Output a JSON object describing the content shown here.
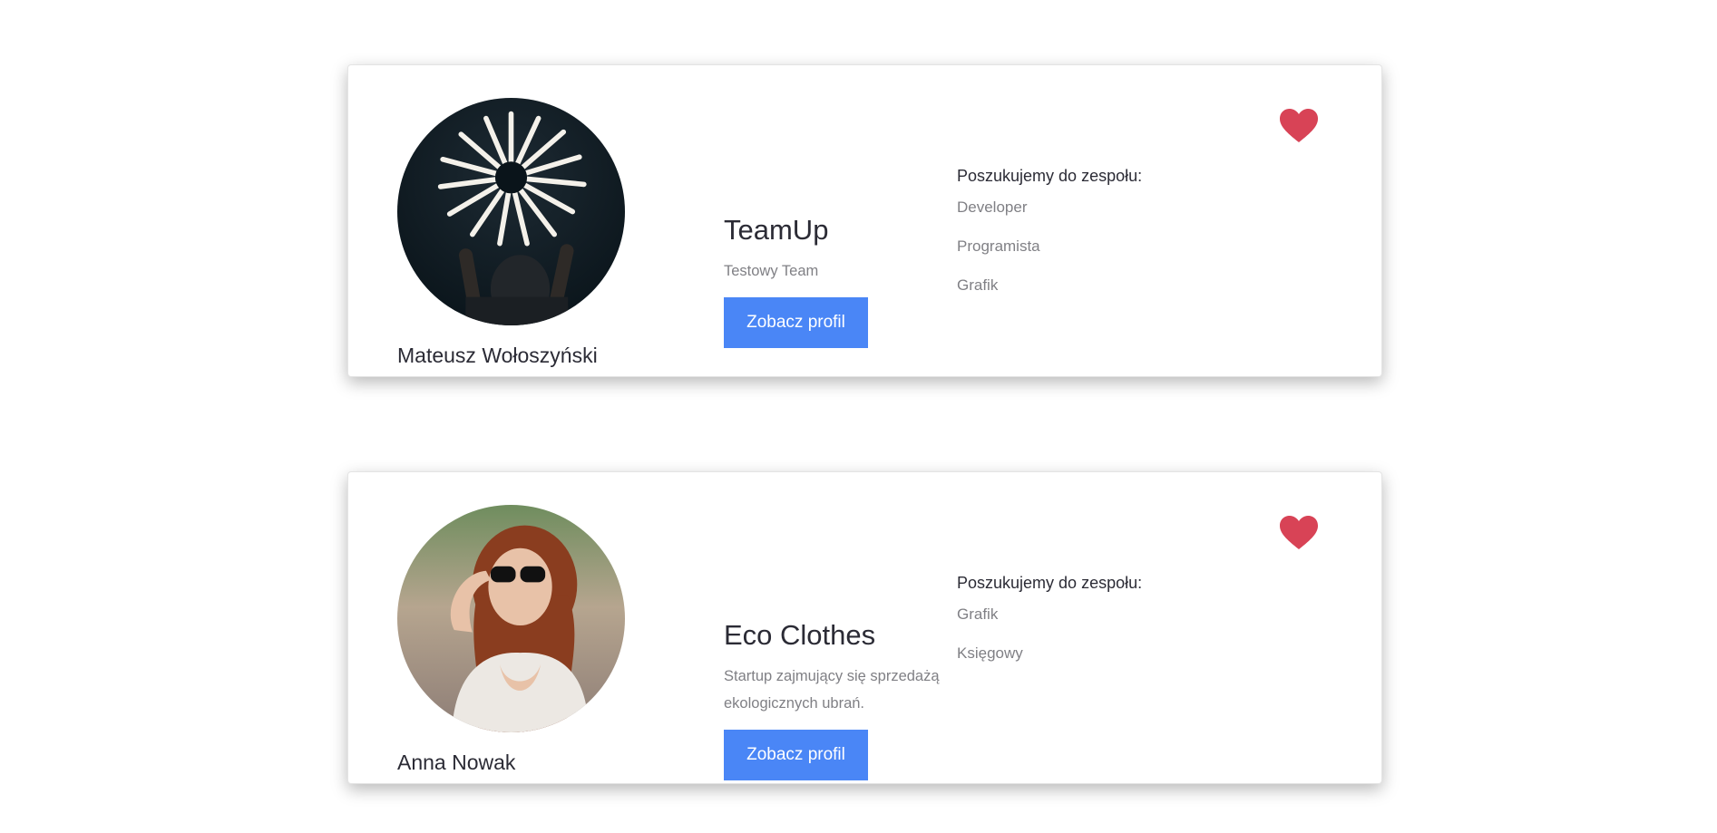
{
  "colors": {
    "accent": "#4a86f6",
    "heart": "#d84356",
    "text_dark": "#2b2b35",
    "text_muted": "#808085"
  },
  "cards": [
    {
      "owner_name": "Mateusz Wołoszyński",
      "avatar_icon": "fireworks-photo",
      "team_name": "TeamUp",
      "team_description": "Testowy Team",
      "button_label": "Zobacz profil",
      "search_title": "Poszukujemy do zespołu:",
      "roles": [
        "Developer",
        "Programista",
        "Grafik"
      ],
      "favorite_icon": "heart-icon"
    },
    {
      "owner_name": "Anna Nowak",
      "avatar_icon": "woman-photo",
      "team_name": "Eco Clothes",
      "team_description": "Startup zajmujący się sprzedażą ekologicznych ubrań.",
      "button_label": "Zobacz profil",
      "search_title": "Poszukujemy do zespołu:",
      "roles": [
        "Grafik",
        "Księgowy"
      ],
      "favorite_icon": "heart-icon"
    }
  ]
}
